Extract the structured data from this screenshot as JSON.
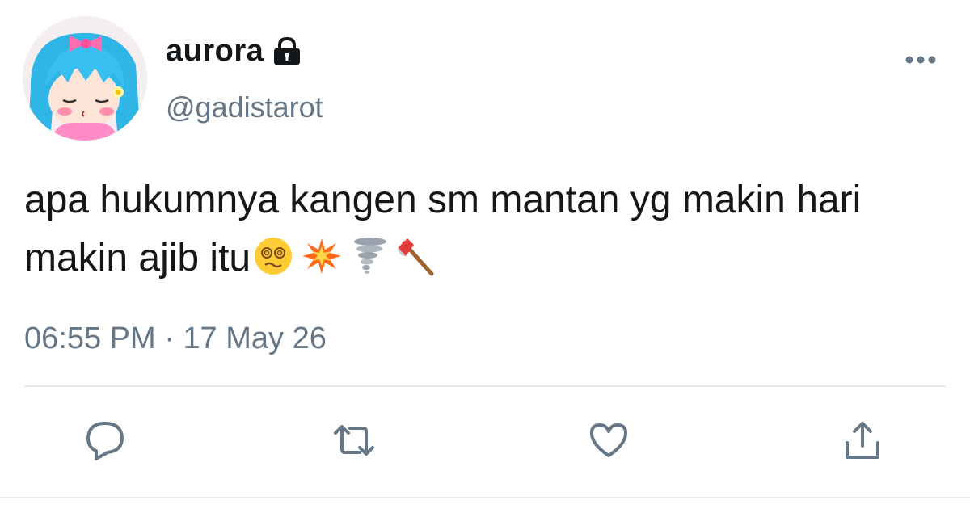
{
  "user": {
    "display_name": "aurora",
    "handle": "@gadistarot",
    "protected": true
  },
  "tweet": {
    "text": "apa hukumnya kangen sm mantan yg makin hari makin ajib itu",
    "emojis": [
      "dizzy-face",
      "collision",
      "tornado",
      "axe"
    ],
    "timestamp": "06:55 PM · 17 May 26"
  },
  "actions": [
    "reply",
    "retweet",
    "like",
    "share"
  ],
  "colors": {
    "text": "#14171a",
    "secondary": "#657786",
    "divider": "#e6ecf0",
    "action": "#657786"
  }
}
